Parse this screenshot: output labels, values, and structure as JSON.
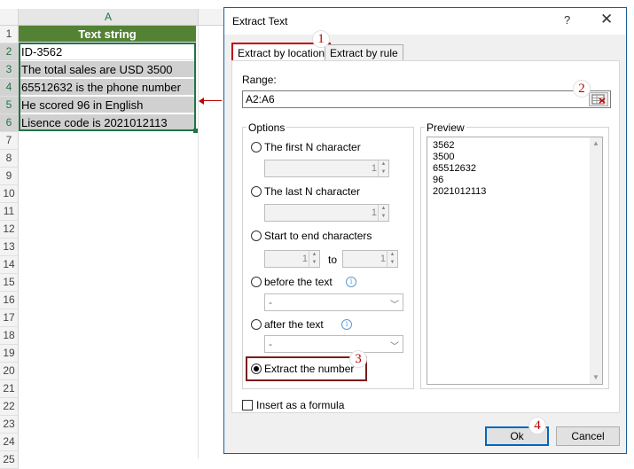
{
  "spreadsheet": {
    "column_header": "A",
    "row_numbers": [
      "1",
      "2",
      "3",
      "4",
      "5",
      "6",
      "7",
      "8",
      "9",
      "10",
      "11",
      "12",
      "13",
      "14",
      "15",
      "16",
      "17",
      "18",
      "19",
      "20",
      "21",
      "22",
      "23",
      "24",
      "25"
    ],
    "header_cell": "Text string",
    "cells": [
      "ID-3562",
      "The total sales are USD 3500",
      "65512632 is the phone number",
      "He scored 96 in English",
      "Lisence code is 2021012113"
    ]
  },
  "dialog": {
    "title": "Extract Text",
    "help_glyph": "?",
    "close_glyph": "✕",
    "tabs": [
      "Extract by location",
      "Extract by rule"
    ],
    "range_label": "Range:",
    "range_value": "A2:A6",
    "options_label": "Options",
    "first_n_label": "The first N character",
    "first_n_value": "1",
    "last_n_label": "The last N character",
    "last_n_value": "1",
    "start_end_label": "Start to end characters",
    "start_value": "1",
    "to_label": "to",
    "end_value": "1",
    "before_label": "before the text",
    "before_value": "-",
    "after_label": "after the text",
    "after_value": "-",
    "extract_number_label": "Extract the number",
    "preview_label": "Preview",
    "preview_lines": [
      "3562",
      "3500",
      "65512632",
      "96",
      "2021012113"
    ],
    "insert_formula_label": "Insert as a formula",
    "ok_label": "Ok",
    "cancel_label": "Cancel",
    "info_glyph": "i"
  },
  "callouts": [
    "1",
    "2",
    "3",
    "4"
  ],
  "colors": {
    "header_green": "#548235",
    "accent_red": "#c00000",
    "ok_border": "#0067c0"
  }
}
